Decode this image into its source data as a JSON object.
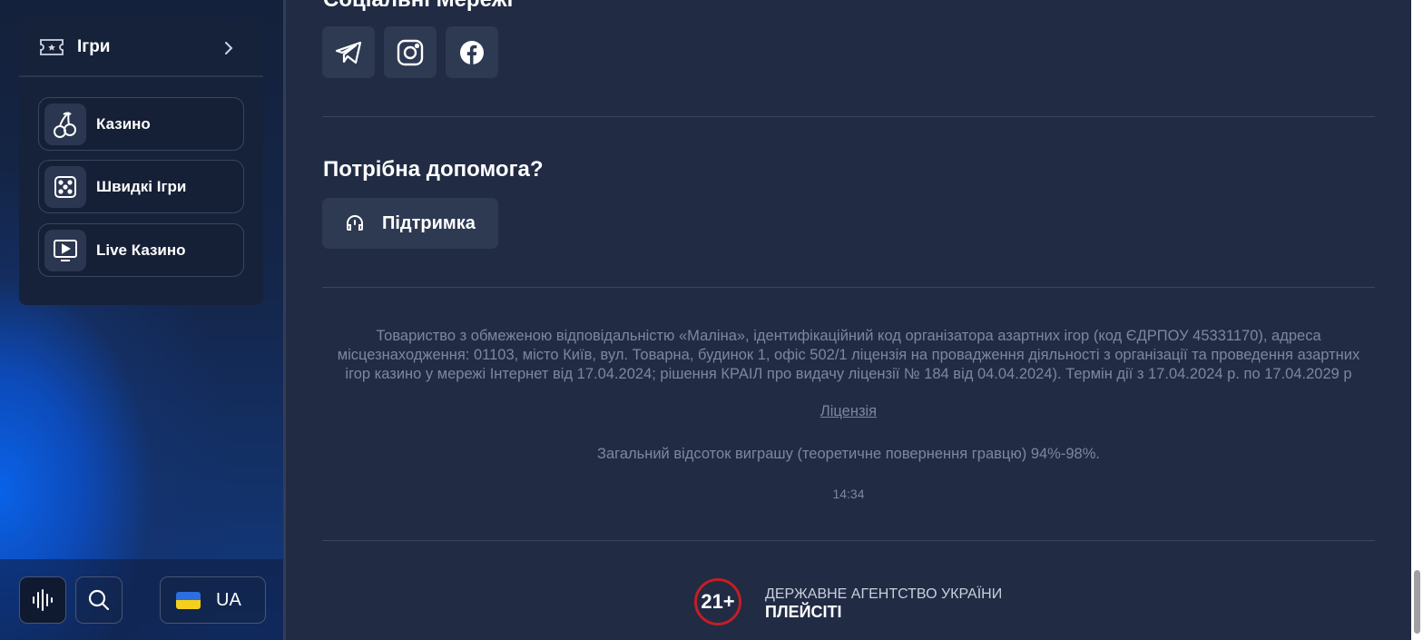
{
  "sidebar": {
    "games_title": "Ігри",
    "items": [
      {
        "label": "Казино",
        "icon": "cherry-icon"
      },
      {
        "label": "Швидкі Ігри",
        "icon": "dice-icon"
      },
      {
        "label": "Live Казино",
        "icon": "live-tv-icon"
      }
    ],
    "language": "UA"
  },
  "main": {
    "social_title": "Соціальні Мережі",
    "social_links": [
      "telegram-icon",
      "instagram-icon",
      "facebook-icon"
    ],
    "help_title": "Потрібна допомога?",
    "support_label": "Підтримка",
    "legal_text": "Товариство з обмеженою відповідальністю «Маліна», ідентифікаційний код організатора азартних ігор (код ЄДРПОУ 45331170), адреса місцезнаходження: 01103, місто Київ, вул. Товарна, будинок 1, офіс 502/1 ліцензія на провадження діяльності з організації та проведення азартних ігор казино у мережі Інтернет від 17.04.2024; рішення КРАІЛ про видачу ліцензії № 184 від 04.04.2024). Термін дії з 17.04.2024 р. по 17.04.2029 р",
    "license_link": "Ліцензія",
    "rtp_text": "Загальний відсоток виграшу (теоретичне повернення гравцю) 94%-98%.",
    "clock": "14:34",
    "age_badge": "21+",
    "agency_line1": "ДЕРЖАВНЕ АГЕНТСТВО УКРАЇНИ",
    "agency_line2": "ПЛЕЙСІТІ"
  },
  "colors": {
    "background": "#212b44",
    "accent_blue": "#0a62e8",
    "age_red": "#c41e24"
  }
}
